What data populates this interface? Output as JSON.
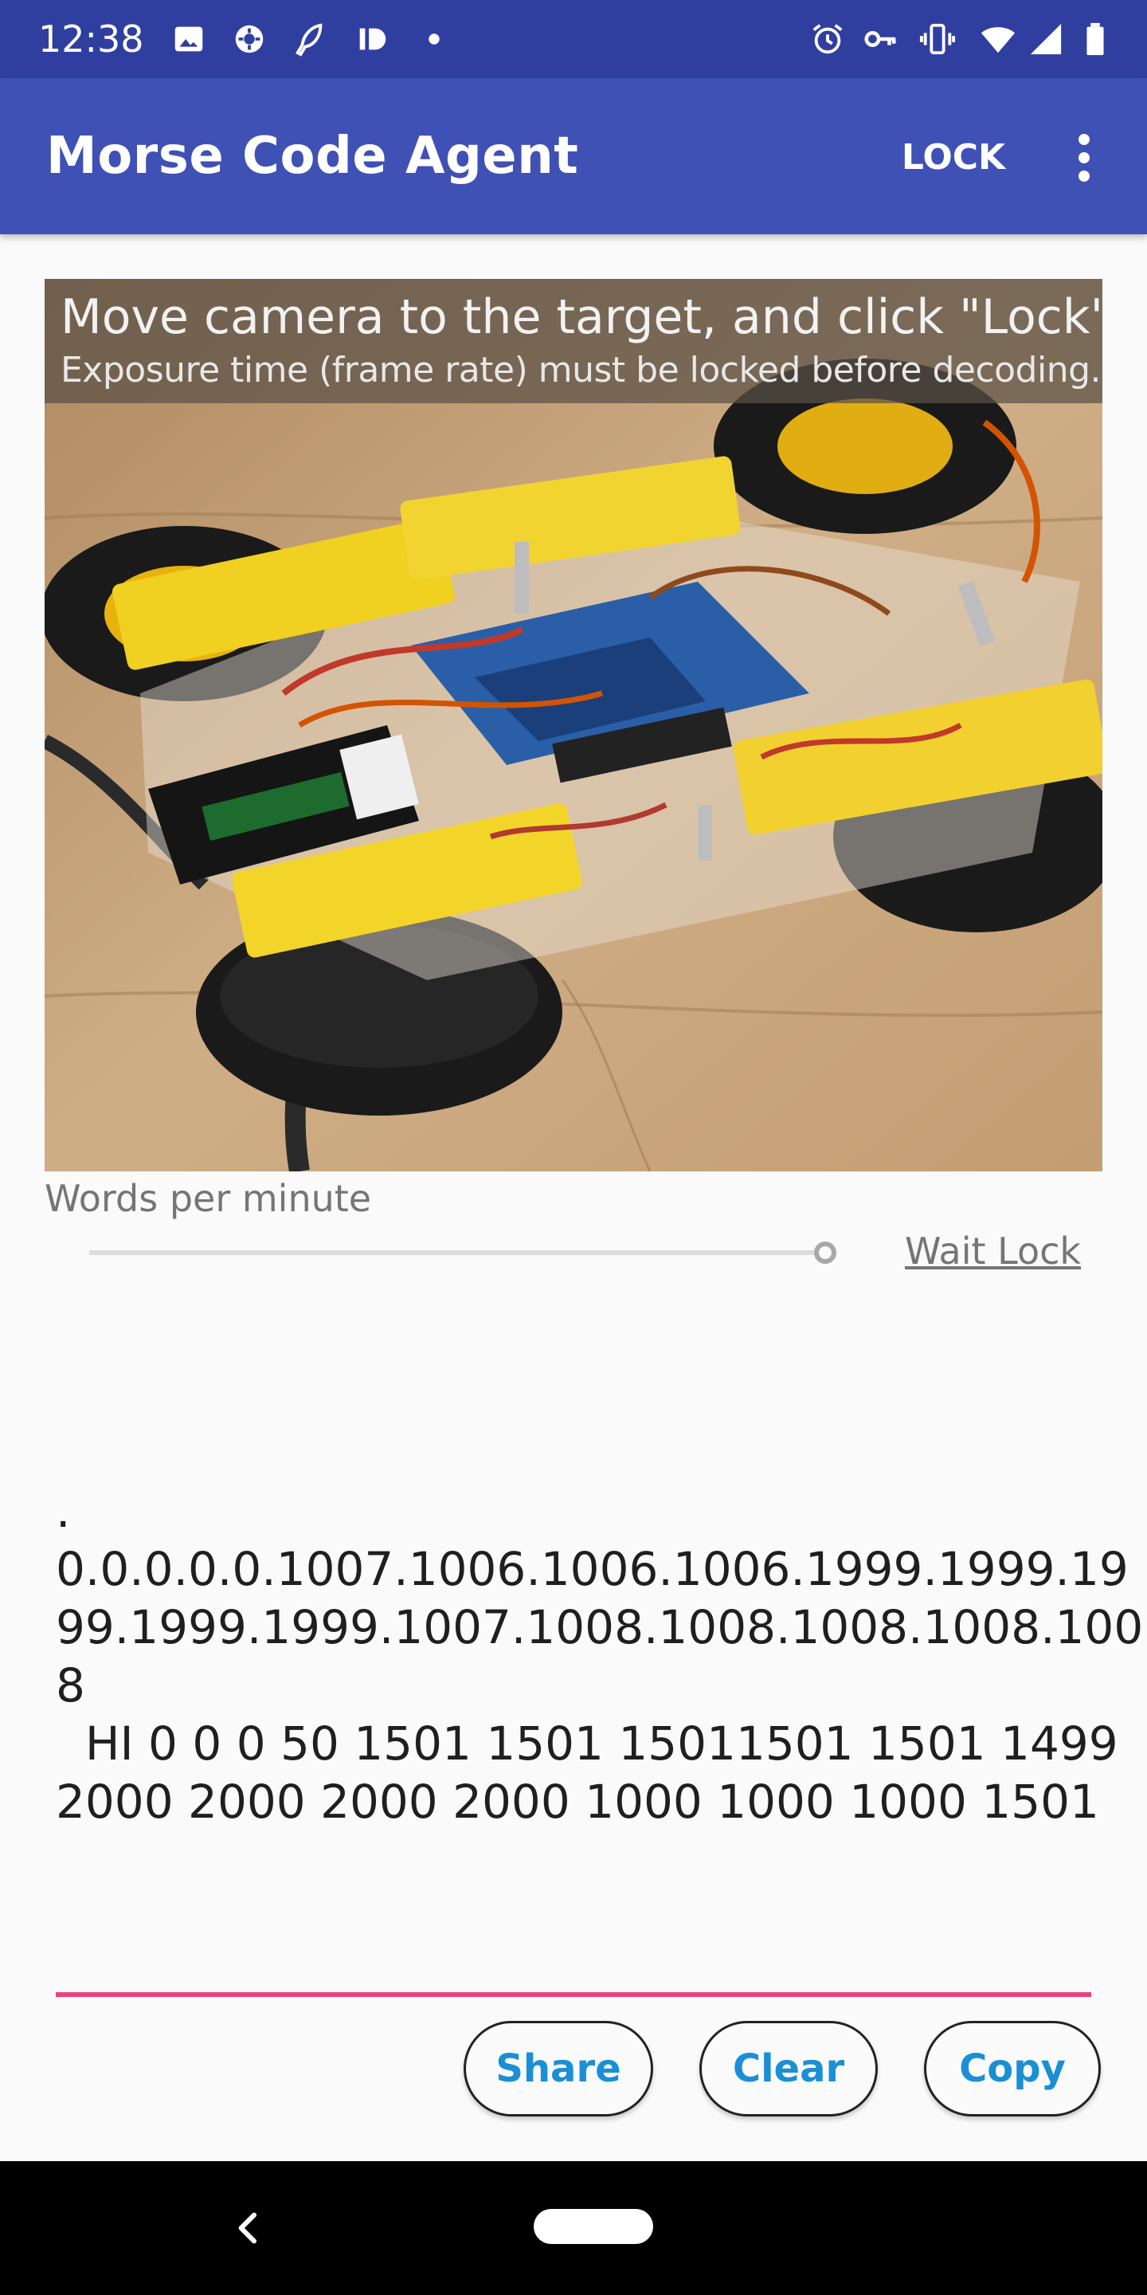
{
  "status_bar": {
    "time": "12:38",
    "left_icons": [
      "image-icon",
      "settings-gear-icon",
      "feather-icon",
      "id-icon",
      "dot-icon"
    ],
    "right_icons": [
      "alarm-icon",
      "key-icon",
      "vibrate-icon",
      "wifi-icon",
      "signal-icon",
      "battery-icon"
    ]
  },
  "app_bar": {
    "title": "Morse Code Agent",
    "lock_label": "LOCK",
    "overflow_icon": "more-vert-icon"
  },
  "camera_preview": {
    "instruction_title": "Move camera to the target, and click \"Lock\"↑",
    "instruction_subtitle": "Exposure time (frame rate) must be locked before decoding."
  },
  "controls": {
    "wpm_label": "Words per minute",
    "wpm_slider_value": 1.0,
    "wait_lock_label": "Wait Lock"
  },
  "decoded": {
    "lines": [
      ".",
      "0.0.0.0.0.1007.1006.1006.1006.1999.1999.19",
      "99.1999.1999.1007.1008.1008.1008.1008.100",
      "8",
      "  HI 0 0 0 50 1501 1501 15011501 1501 1499",
      "2000 2000 2000 2000 1000 1000 1000 1501"
    ]
  },
  "buttons": {
    "share": "Share",
    "clear": "Clear",
    "copy": "Copy"
  },
  "colors": {
    "status_bar": "#303f9f",
    "app_bar": "#3f51b5",
    "accent_underline": "#e8437a",
    "button_text": "#1a8fd6"
  }
}
